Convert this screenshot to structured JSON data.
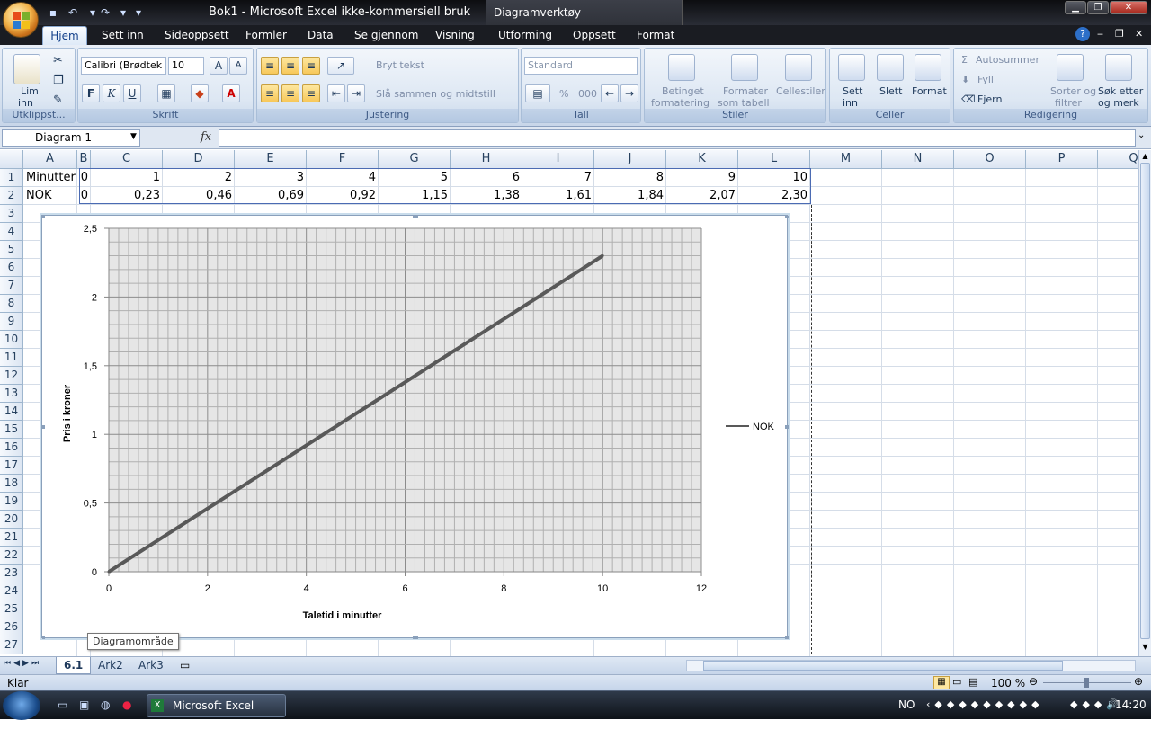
{
  "window": {
    "title": "Bok1 - Microsoft Excel ikke-kommersiell bruk",
    "context_tools": "Diagramverktøy"
  },
  "tabs": [
    "Hjem",
    "Settinn",
    "Sideoppsett",
    "Formler",
    "Data",
    "Se gjennom",
    "Visning",
    "Utforming",
    "Oppsett",
    "Format"
  ],
  "tabs_display": {
    "home": "Hjem",
    "insert": "Sett inn",
    "layout": "Sideoppsett",
    "formulas": "Formler",
    "data": "Data",
    "review": "Se gjennom",
    "view": "Visning",
    "design": "Utforming",
    "chart_layout": "Oppsett",
    "format": "Format"
  },
  "ribbon": {
    "clipboard": {
      "label": "Utklippst...",
      "paste": "Lim",
      "paste2": "inn"
    },
    "font": {
      "label": "Skrift",
      "name": "Calibri (Brødtek",
      "size": "10",
      "bold": "F",
      "italic": "K",
      "underline": "U"
    },
    "alignment": {
      "label": "Justering",
      "wrap": "Bryt tekst",
      "merge": "Slå sammen og midtstill"
    },
    "number": {
      "label": "Tall",
      "format": "Standard",
      "percent": "%",
      "thousands": "000"
    },
    "styles": {
      "label": "Stiler",
      "cond1": "Betinget",
      "cond2": "formatering",
      "table1": "Formater",
      "table2": "som tabell",
      "cell": "Cellestiler"
    },
    "cells": {
      "label": "Celler",
      "insert1": "Sett",
      "insert2": "inn",
      "delete": "Slett",
      "format": "Format"
    },
    "editing": {
      "label": "Redigering",
      "autosum": "Autosummer",
      "fill": "Fyll",
      "clear": "Fjern",
      "sort1": "Sorter og",
      "sort2": "filtrer",
      "find1": "Søk etter",
      "find2": "og merk"
    }
  },
  "formula_bar": {
    "name_box": "Diagram 1",
    "fx": "fx",
    "formula": ""
  },
  "columns": [
    "A",
    "B",
    "C",
    "D",
    "E",
    "F",
    "G",
    "H",
    "I",
    "J",
    "K",
    "L",
    "M",
    "N",
    "O",
    "P",
    "Q"
  ],
  "rows": [
    "1",
    "2",
    "3",
    "4",
    "5",
    "6",
    "7",
    "8",
    "9",
    "10",
    "11",
    "12",
    "13",
    "14",
    "15",
    "16",
    "17",
    "18",
    "19",
    "20",
    "21",
    "22",
    "23",
    "24",
    "25",
    "26",
    "27"
  ],
  "cells": {
    "row1": [
      "Minutter",
      "0",
      "1",
      "2",
      "3",
      "4",
      "5",
      "6",
      "7",
      "8",
      "9",
      "10"
    ],
    "row2": [
      "NOK",
      "0",
      "0,23",
      "0,46",
      "0,69",
      "0,92",
      "1,15",
      "1,38",
      "1,61",
      "1,84",
      "2,07",
      "2,30"
    ]
  },
  "chart_data": {
    "type": "line",
    "title": "",
    "xlabel": "Taletid i minutter",
    "ylabel": "Pris i kroner",
    "xlim": [
      0,
      12
    ],
    "ylim": [
      0,
      2.5
    ],
    "x_ticks": [
      "0",
      "2",
      "4",
      "6",
      "8",
      "10",
      "12"
    ],
    "y_ticks": [
      "0",
      "0,5",
      "1",
      "1,5",
      "2",
      "2,5"
    ],
    "grid": true,
    "legend_position": "right",
    "series": [
      {
        "name": "NOK",
        "color": "#595959",
        "x": [
          0,
          1,
          2,
          3,
          4,
          5,
          6,
          7,
          8,
          9,
          10
        ],
        "y": [
          0,
          0.23,
          0.46,
          0.69,
          0.92,
          1.15,
          1.38,
          1.61,
          1.84,
          2.07,
          2.3
        ]
      }
    ]
  },
  "tooltip": "Diagramområde",
  "sheets": [
    "6.1",
    "Ark2",
    "Ark3"
  ],
  "status": {
    "ready": "Klar",
    "zoom": "100 %"
  },
  "taskbar": {
    "item": "Microsoft Excel ikke...",
    "lang": "NO",
    "time": "14:20"
  }
}
